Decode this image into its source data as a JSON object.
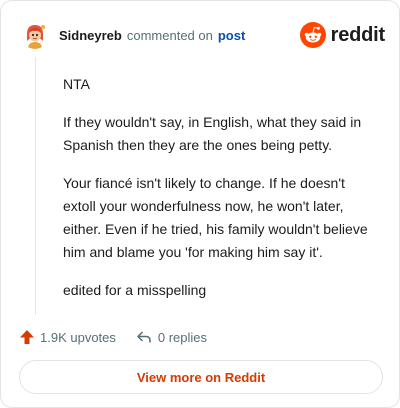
{
  "comment": {
    "username": "Sidneyreb",
    "action_text": "commented on",
    "post_link": "post",
    "avatar_icon": "user-avatar-icon",
    "paragraphs": [
      "NTA",
      "If they wouldn't say, in English, what they said in Spanish then they are the ones being petty.",
      "Your fiancé isn't likely to change. If he doesn't extoll your wonderfulness now, he won't later, either. Even if he tried, his family wouldn't believe him and blame you 'for making him say it'.",
      "edited for a misspelling"
    ]
  },
  "brand": {
    "logo_text": "reddit",
    "logo_icon": "reddit-logo-icon",
    "accent_color": "#ff4500"
  },
  "actions": {
    "upvotes_label": "1.9K upvotes",
    "replies_label": "0 replies",
    "upvote_icon": "upvote-arrow-icon",
    "reply_icon": "reply-icon"
  },
  "footer": {
    "view_more_label": "View more on Reddit"
  }
}
